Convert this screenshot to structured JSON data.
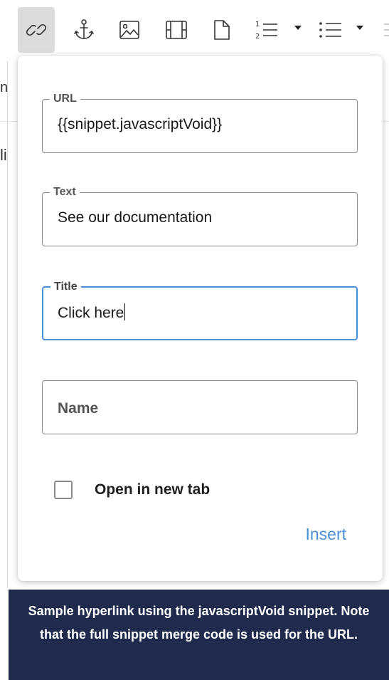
{
  "toolbar": {
    "buttons": [
      {
        "icon": "link-icon",
        "active": true
      },
      {
        "icon": "anchor-icon"
      },
      {
        "icon": "image-icon"
      },
      {
        "icon": "video-icon"
      },
      {
        "icon": "file-icon"
      },
      {
        "icon": "numbered-list-icon",
        "has_dropdown": true
      },
      {
        "icon": "bulleted-list-icon",
        "has_dropdown": true
      }
    ]
  },
  "background": {
    "glyph_1": "n",
    "glyph_2": "li"
  },
  "dialog": {
    "url": {
      "label": "URL",
      "value": "{{snippet.javascriptVoid}}"
    },
    "text": {
      "label": "Text",
      "value": "See our documentation"
    },
    "title": {
      "label": "Title",
      "value": "Click here"
    },
    "name": {
      "placeholder": "Name",
      "value": ""
    },
    "open_new_tab": {
      "label": "Open in new tab",
      "checked": false
    },
    "insert_label": "Insert"
  },
  "caption": {
    "text": "Sample hyperlink using the javascriptVoid snippet. Note that the full snippet merge code is used for the URL."
  },
  "colors": {
    "accent": "#4a90d9",
    "caption_bg": "#1f2a4c",
    "active_button_bg": "#dcdcdc"
  }
}
